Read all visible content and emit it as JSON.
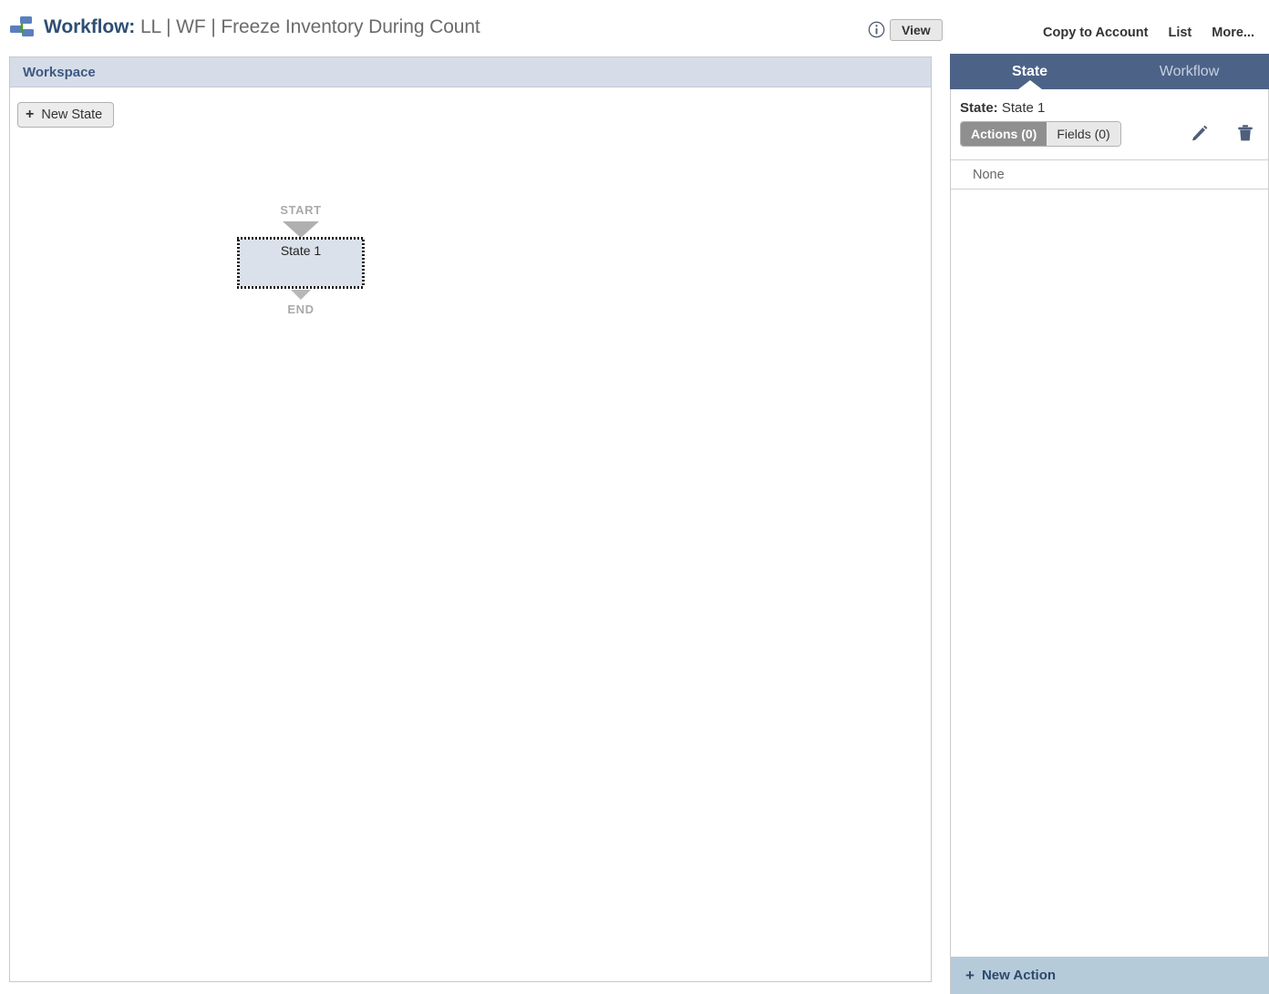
{
  "header": {
    "icon": "workflow-hierarchy-icon",
    "title_lead": "Workflow:",
    "title_rest": " LL | WF | Freeze Inventory During Count",
    "info_icon": "info-circle-icon",
    "view_button": "View",
    "links": [
      {
        "label": "Copy to Account"
      },
      {
        "label": "List"
      },
      {
        "label": "More..."
      }
    ]
  },
  "workspace": {
    "header_label": "Workspace",
    "new_state_button": "New State",
    "plus_glyph": "+",
    "diagram": {
      "start_label": "START",
      "end_label": "END",
      "states": [
        {
          "label": "State 1",
          "selected": true
        }
      ]
    }
  },
  "panel": {
    "tabs": [
      {
        "label": "State",
        "active": true
      },
      {
        "label": "Workflow",
        "active": false
      }
    ],
    "state_prefix": "State:",
    "state_value": "State 1",
    "toggles": [
      {
        "label": "Actions (0)",
        "active": true
      },
      {
        "label": "Fields (0)",
        "active": false
      }
    ],
    "edit_icon": "pencil-icon",
    "delete_icon": "trash-icon",
    "list_rows": [
      {
        "label": "None"
      }
    ],
    "footer": {
      "plus_glyph": "+",
      "label": "New Action"
    }
  },
  "colors": {
    "panel_header": "#4d6287",
    "workspace_header": "#d6dde9",
    "footer_bar": "#b6cbda",
    "state_fill": "#dbe1ea",
    "title_accent": "#2f4f73"
  }
}
